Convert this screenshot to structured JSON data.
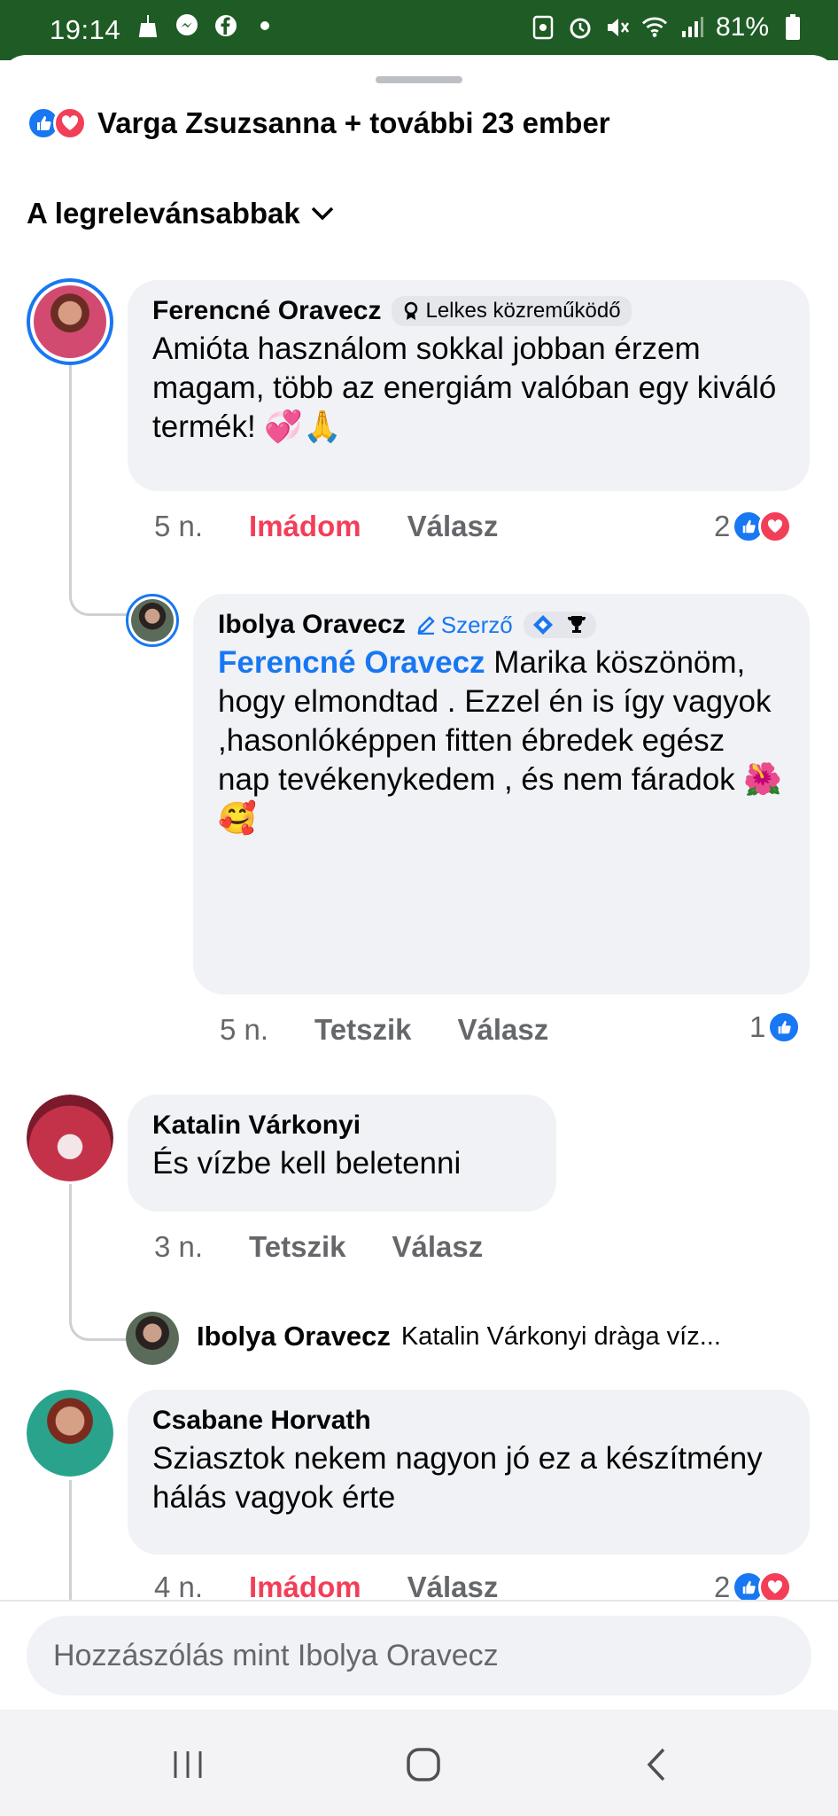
{
  "status_bar": {
    "time": "19:14",
    "battery": "81%"
  },
  "header": {
    "reactors": "Varga Zsuzsanna + további 23 ember",
    "sort_label": "A legrelevánsabbak"
  },
  "comments": [
    {
      "author": "Ferencné Oravecz",
      "badge": "Lelkes közreműködő",
      "text": "Amióta használom sokkal jobban érzem magam, több az energiám valóban egy kiváló termék! 💞🙏",
      "time": "5 n.",
      "like_label": "Imádom",
      "reply_label": "Válasz",
      "reaction_count": "2",
      "reply": {
        "author": "Ibolya Oravecz",
        "author_badge": "Szerző",
        "mention": "Ferencné Oravecz",
        "text": "Marika köszönöm, hogy elmondtad . Ezzel én is így vagyok ,hasonlóképpen fitten ébredek egész nap tevékenykedem , és nem fáradok 🌺🥰",
        "time": "5 n.",
        "like_label": "Tetszik",
        "reply_label": "Válasz",
        "reaction_count": "1"
      }
    },
    {
      "author": "Katalin Várkonyi",
      "text": "És vízbe kell beletenni",
      "time": "3 n.",
      "like_label": "Tetszik",
      "reply_label": "Válasz",
      "collapsed_reply": {
        "author": "Ibolya Oravecz",
        "preview": "Katalin Várkonyi dràga víz..."
      }
    },
    {
      "author": "Csabane Horvath",
      "text": "Sziasztok nekem nagyon jó ez a készítmény hálás vagyok érte",
      "time": "4 n.",
      "like_label": "Imádom",
      "reply_label": "Válasz",
      "reaction_count": "2"
    }
  ],
  "composer": {
    "placeholder": "Hozzászólás mint Ibolya Oravecz"
  },
  "icons": {
    "status": [
      "broom-icon",
      "messenger-icon",
      "facebook-icon",
      "dot-icon",
      "nfc-icon",
      "alarm-icon",
      "mute-icon",
      "wifi-icon",
      "signal-icon",
      "battery-icon"
    ],
    "reactions": [
      "like-icon",
      "love-icon"
    ],
    "nav": [
      "recents-icon",
      "home-icon",
      "back-icon"
    ]
  },
  "colors": {
    "status_bar": "#1f5b25",
    "accent": "#1877f2",
    "love": "#f33e58",
    "bubble": "#f0f2f5"
  }
}
